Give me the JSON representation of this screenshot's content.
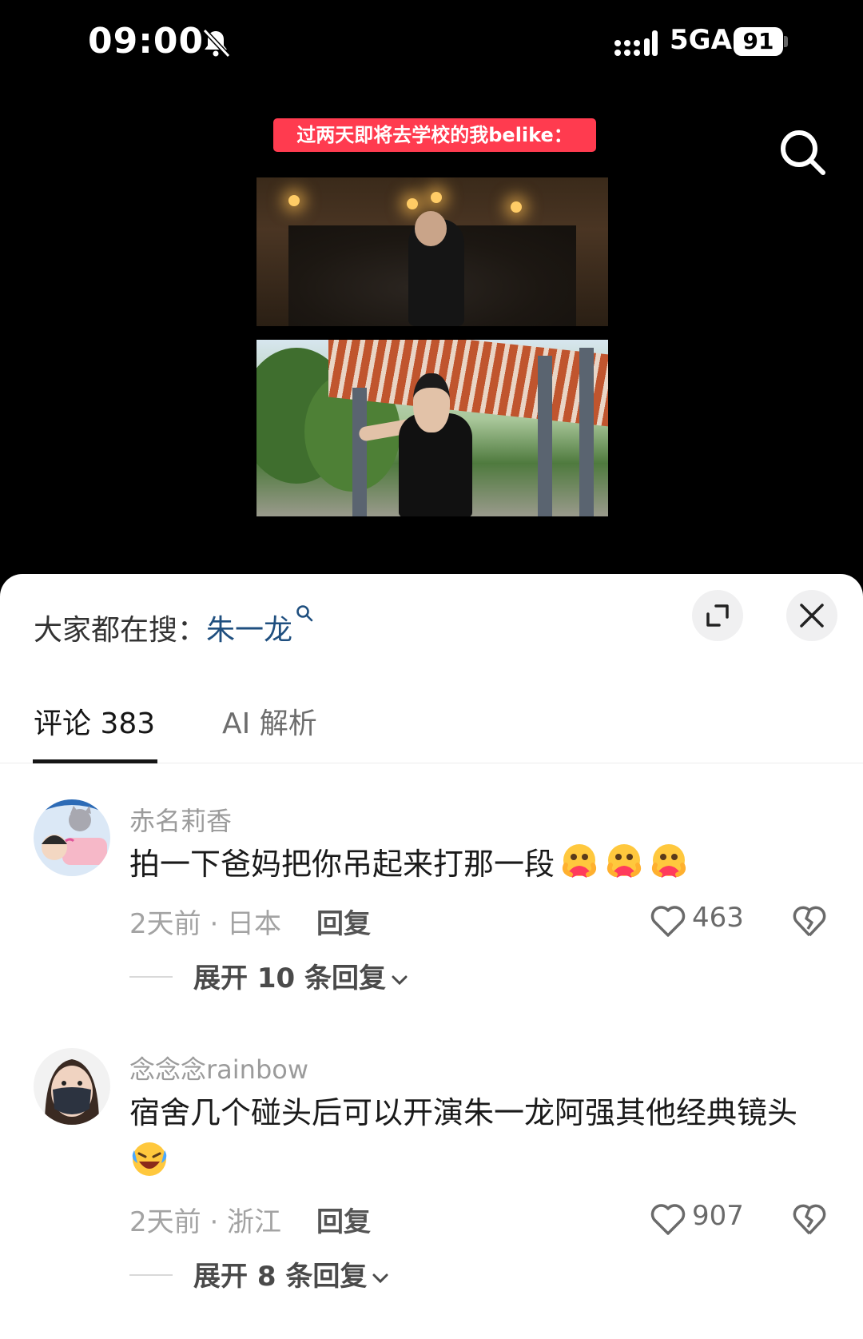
{
  "status_bar": {
    "time": "09:00",
    "network": "5GA",
    "battery": "91"
  },
  "video": {
    "caption": "过两天即将去学校的我belike："
  },
  "sheet": {
    "trending_prefix": "大家都在搜：",
    "trending_keyword": "朱一龙",
    "tabs": [
      {
        "label": "评论 383"
      },
      {
        "label": "AI 解析"
      }
    ]
  },
  "comments": [
    {
      "username": "赤名莉香",
      "text": "拍一下爸妈把你吊起来打那一段",
      "emoji": "hug-face-emoji x3",
      "time_location": "2天前 · 日本",
      "reply_label": "回复",
      "likes": "463",
      "expand_label": "展开 10 条回复"
    },
    {
      "username": "念念念rainbow",
      "text": "宿舍几个碰头后可以开演朱一龙阿强其他经典镜头",
      "emoji": "crying-laughing-emoji",
      "time_location": "2天前 · 浙江",
      "reply_label": "回复",
      "likes": "907",
      "expand_label": "展开 8 条回复"
    }
  ],
  "colors": {
    "caption_bg": "#ff3b4f",
    "keyword": "#1f4f7f"
  }
}
